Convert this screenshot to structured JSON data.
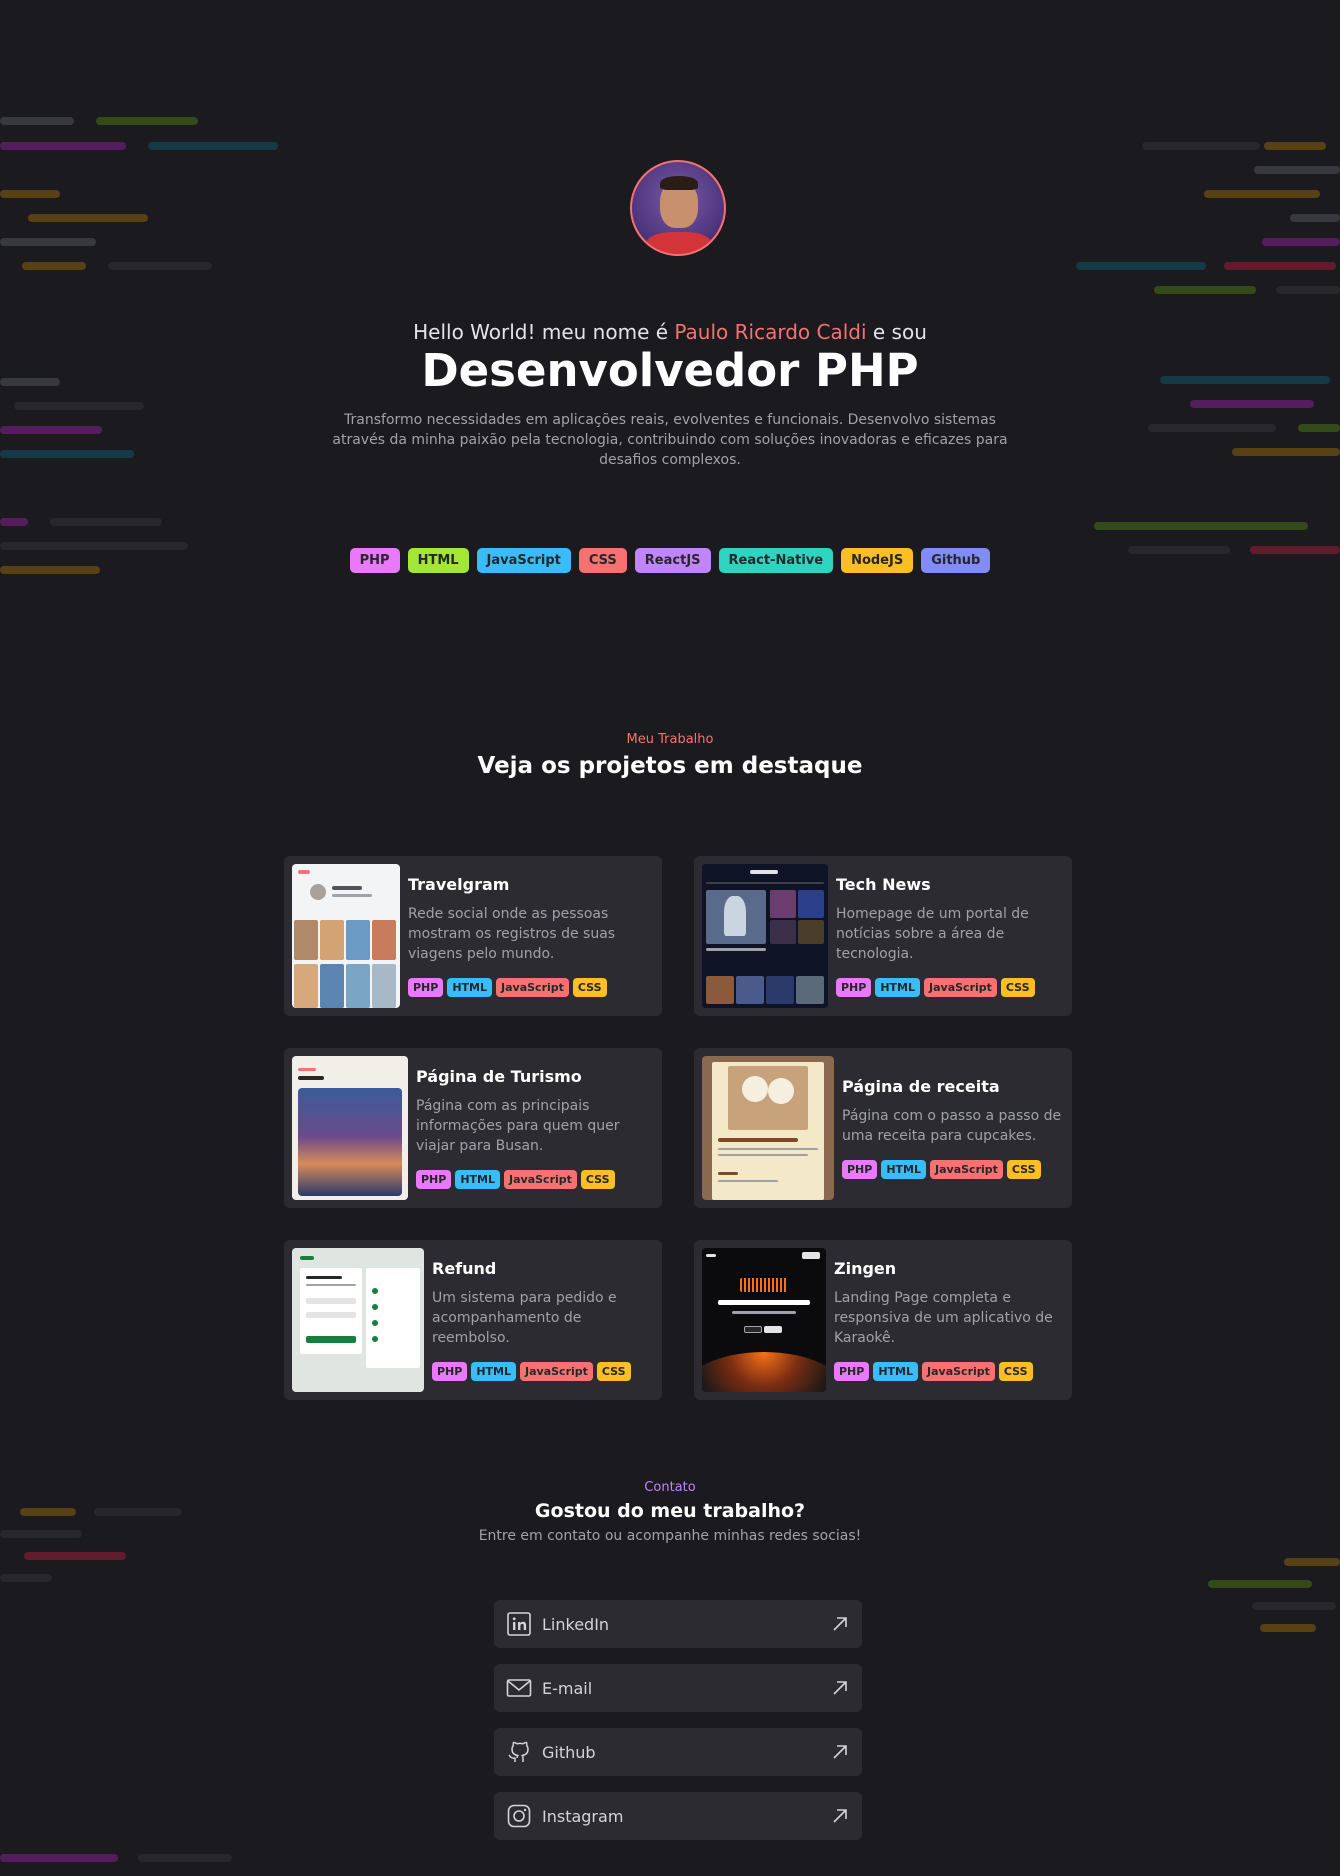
{
  "hero": {
    "greeting_prefix": "Hello World! meu nome é",
    "name": "Paulo Ricardo Caldi",
    "greeting_suffix": "e sou",
    "title": "Desenvolvedor PHP",
    "description": "Transformo necessidades em aplicações reais, evolventes e funcionais. Desenvolvo sistemas através da minha paixão pela tecnologia, contribuindo com soluções inovadoras e eficazes para desafios complexos."
  },
  "tech": [
    {
      "label": "PHP",
      "color": "#e879f9"
    },
    {
      "label": "HTML",
      "color": "#a3e635"
    },
    {
      "label": "JavaScript",
      "color": "#38bdf8"
    },
    {
      "label": "CSS",
      "color": "#f87171"
    },
    {
      "label": "ReactJS",
      "color": "#c084fc"
    },
    {
      "label": "React-Native",
      "color": "#2dd4bf"
    },
    {
      "label": "NodeJS",
      "color": "#fbbf24"
    },
    {
      "label": "Github",
      "color": "#818cf8"
    }
  ],
  "projects_section": {
    "label": "Meu Trabalho",
    "title": "Veja os projetos em destaque"
  },
  "projects": [
    {
      "title": "Travelgram",
      "description": "Rede social onde as pessoas mostram os registros de suas viagens pelo mundo.",
      "tags": [
        "PHP",
        "HTML",
        "JavaScript",
        "CSS"
      ]
    },
    {
      "title": "Tech News",
      "description": "Homepage de um portal de notícias sobre a área de tecnologia.",
      "tags": [
        "PHP",
        "HTML",
        "JavaScript",
        "CSS"
      ]
    },
    {
      "title": "Página de Turismo",
      "description": "Página com as principais informações para quem quer viajar para Busan.",
      "tags": [
        "PHP",
        "HTML",
        "JavaScript",
        "CSS"
      ]
    },
    {
      "title": "Página de receita",
      "description": "Página com o passo a passo de uma receita para cupcakes.",
      "tags": [
        "PHP",
        "HTML",
        "JavaScript",
        "CSS"
      ]
    },
    {
      "title": "Refund",
      "description": "Um sistema para pedido e acompanhamento de reembolso.",
      "tags": [
        "PHP",
        "HTML",
        "JavaScript",
        "CSS"
      ]
    },
    {
      "title": "Zingen",
      "description": "Landing Page completa e responsiva de um aplicativo de Karaokê.",
      "tags": [
        "PHP",
        "HTML",
        "JavaScript",
        "CSS"
      ]
    }
  ],
  "tag_colors": {
    "PHP": "#e879f9",
    "HTML": "#38bdf8",
    "JavaScript": "#f87171",
    "CSS": "#fbbf24"
  },
  "contact_section": {
    "label": "Contato",
    "title": "Gostou do meu trabalho?",
    "subtitle": "Entre em contato ou acompanhe minhas redes socias!"
  },
  "contacts": [
    {
      "label": "LinkedIn",
      "icon": "linkedin-icon"
    },
    {
      "label": "E-mail",
      "icon": "mail-icon"
    },
    {
      "label": "Github",
      "icon": "github-icon"
    },
    {
      "label": "Instagram",
      "icon": "instagram-icon"
    }
  ],
  "colors": {
    "background": "#1b1b1f",
    "card": "#2b2b31",
    "accent_red": "#f87171",
    "accent_purple": "#c084fc"
  }
}
